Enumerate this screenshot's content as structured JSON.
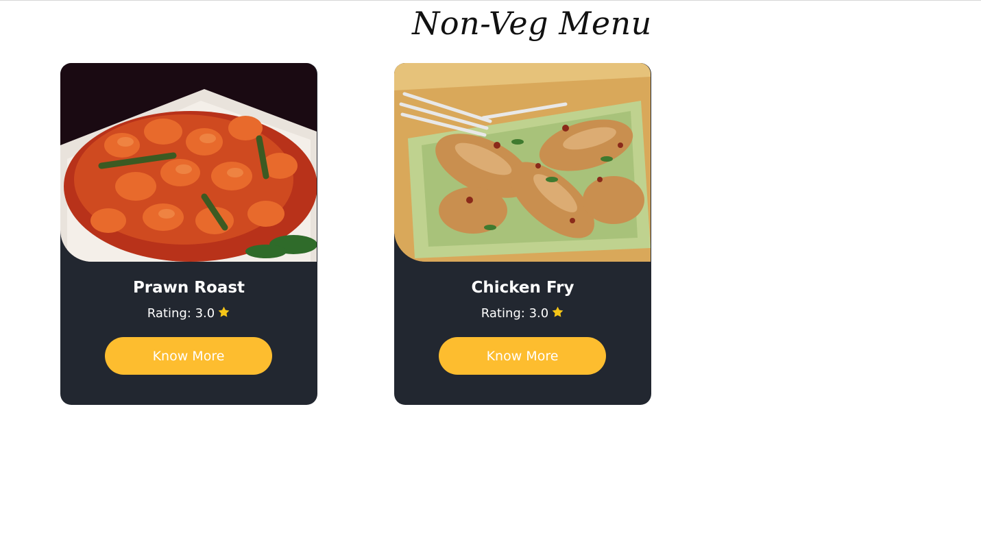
{
  "page": {
    "title": "Non-Veg Menu"
  },
  "colors": {
    "card_bg": "#222730",
    "button_bg": "#fdbd2f",
    "star": "#f5c518"
  },
  "cards": [
    {
      "name": "Prawn Roast",
      "rating_label": "Rating: 3.0",
      "rating": 3.0,
      "button_label": "Know More",
      "icon": "star-icon"
    },
    {
      "name": "Chicken Fry",
      "rating_label": "Rating: 3.0",
      "rating": 3.0,
      "button_label": "Know More",
      "icon": "star-icon"
    }
  ]
}
